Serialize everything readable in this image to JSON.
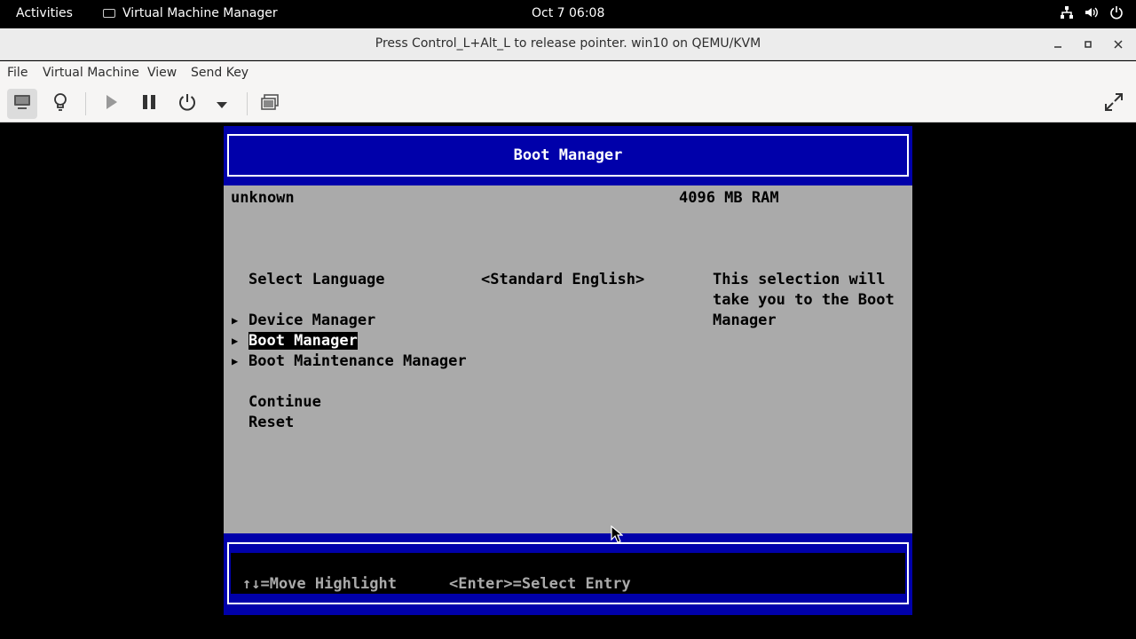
{
  "topbar": {
    "activities": "Activities",
    "app_name": "Virtual Machine Manager",
    "clock": "Oct 7  06:08"
  },
  "window": {
    "title": "Press Control_L+Alt_L to release pointer. win10 on QEMU/KVM"
  },
  "menubar": {
    "items": [
      "File",
      "Virtual Machine",
      "View",
      "Send Key"
    ]
  },
  "bios": {
    "header": "Boot Manager",
    "platform": "unknown",
    "ram": "4096 MB RAM",
    "language_label": "Select Language",
    "language_value": "<Standard English>",
    "menu": [
      {
        "label": "Device Manager",
        "submenu": true
      },
      {
        "label": "Boot Manager",
        "submenu": true,
        "selected": true
      },
      {
        "label": "Boot Maintenance Manager",
        "submenu": true
      }
    ],
    "actions": [
      "Continue",
      "Reset"
    ],
    "help": [
      "This selection will",
      "take you to the Boot",
      "Manager"
    ],
    "footer": {
      "move": "↑↓=Move Highlight",
      "select": "<Enter>=Select Entry"
    },
    "colors": {
      "blue": "#0000aa",
      "gray": "#aaaaaa"
    }
  }
}
